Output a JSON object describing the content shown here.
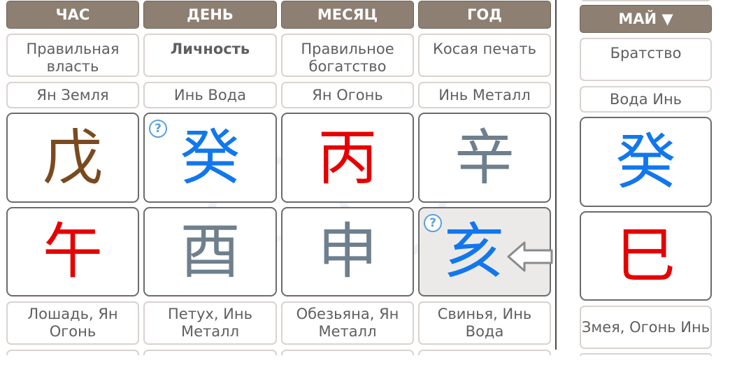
{
  "columns": [
    {
      "header": "ЧАС",
      "star": "Правильная власть",
      "stem_element": "Ян Земля",
      "stem_char": "戊",
      "stem_color": "#7a4a1f",
      "branch_char": "午",
      "branch_color": "#e60000",
      "branch_desc": "Лошадь, Ян Огонь"
    },
    {
      "header": "ДЕНЬ",
      "star": "Личность",
      "stem_element": "Инь Вода",
      "stem_char": "癸",
      "stem_color": "#1177ee",
      "branch_char": "酉",
      "branch_color": "#6e7f8d",
      "branch_desc": "Петух, Инь Металл",
      "help": "?"
    },
    {
      "header": "МЕСЯЦ",
      "star": "Правильное богатство",
      "stem_element": "Ян Огонь",
      "stem_char": "丙",
      "stem_color": "#e60000",
      "branch_char": "申",
      "branch_color": "#6e7f8d",
      "branch_desc": "Обезьяна, Ян Металл"
    },
    {
      "header": "ГОД",
      "star": "Косая печать",
      "stem_element": "Инь Металл",
      "stem_char": "辛",
      "stem_color": "#6e7f8d",
      "branch_char": "亥",
      "branch_color": "#1177ee",
      "branch_desc": "Свинья, Инь Вода",
      "help": "?"
    }
  ],
  "luck": {
    "header": "МАЙ ▼",
    "star": "Братство",
    "stem_element": "Вода Инь",
    "stem_char": "癸",
    "stem_color": "#1177ee",
    "branch_char": "巳",
    "branch_color": "#e60000",
    "branch_desc": "Змея, Огонь Инь"
  },
  "icons": {
    "left_arrow": "arrow-left-outline-icon",
    "right_arrow": "arrow-right-outline-icon",
    "help": "question-circle-icon"
  }
}
